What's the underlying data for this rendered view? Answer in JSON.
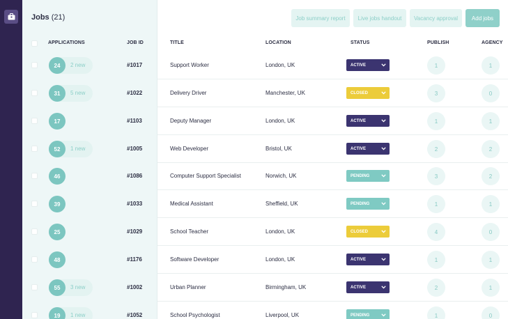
{
  "header": {
    "title": "Jobs",
    "count": "(21)",
    "buttons": {
      "job_summary": "Job summary report",
      "live_handout": "Live jobs handout",
      "vacancy_approval": "Vacancy approval",
      "add_jobs": "Add jobs"
    }
  },
  "columns": {
    "applications": "APPLICATIONS",
    "job_id": "JOB ID",
    "title": "TITLE",
    "location": "LOCATION",
    "status": "STATUS",
    "publish": "PUBLISH",
    "agency": "AGENCY"
  },
  "colors": {
    "sidebar": "#2f2450",
    "accent": "#7cc6c0",
    "active": "#3b3470",
    "closed": "#eccc3a",
    "pending": "#7fcac3"
  },
  "rows": [
    {
      "applications": "24",
      "new": "2 new",
      "job_id": "#1017",
      "title": "Support Worker",
      "location": "London, UK",
      "status": "ACTIVE",
      "publish": "1",
      "agency": "1"
    },
    {
      "applications": "31",
      "new": "5 new",
      "job_id": "#1022",
      "title": "Delivery Driver",
      "location": "Manchester, UK",
      "status": "CLOSED",
      "publish": "3",
      "agency": "0"
    },
    {
      "applications": "17",
      "new": "",
      "job_id": "#1103",
      "title": "Deputy Manager",
      "location": "London, UK",
      "status": "ACTIVE",
      "publish": "1",
      "agency": "1"
    },
    {
      "applications": "52",
      "new": "1 new",
      "job_id": "#1005",
      "title": "Web Developer",
      "location": "Bristol, UK",
      "status": "ACTIVE",
      "publish": "2",
      "agency": "2"
    },
    {
      "applications": "46",
      "new": "",
      "job_id": "#1086",
      "title": "Computer Support Specialist",
      "location": "Norwich, UK",
      "status": "PENDING",
      "publish": "3",
      "agency": "2"
    },
    {
      "applications": "39",
      "new": "",
      "job_id": "#1033",
      "title": "Medical Assistant",
      "location": "Sheffield, UK",
      "status": "PENDING",
      "publish": "1",
      "agency": "1"
    },
    {
      "applications": "25",
      "new": "",
      "job_id": "#1029",
      "title": "School Teacher",
      "location": "London, UK",
      "status": "CLOSED",
      "publish": "4",
      "agency": "0"
    },
    {
      "applications": "48",
      "new": "",
      "job_id": "#1176",
      "title": "Software Developer",
      "location": "London, UK",
      "status": "ACTIVE",
      "publish": "1",
      "agency": "1"
    },
    {
      "applications": "55",
      "new": "3 new",
      "job_id": "#1002",
      "title": "Urban Planner",
      "location": "Birmingham, UK",
      "status": "ACTIVE",
      "publish": "2",
      "agency": "1"
    },
    {
      "applications": "19",
      "new": "1 new",
      "job_id": "#1052",
      "title": "School Psychologist",
      "location": "Liverpool, UK",
      "status": "PENDING",
      "publish": "1",
      "agency": "0"
    }
  ]
}
